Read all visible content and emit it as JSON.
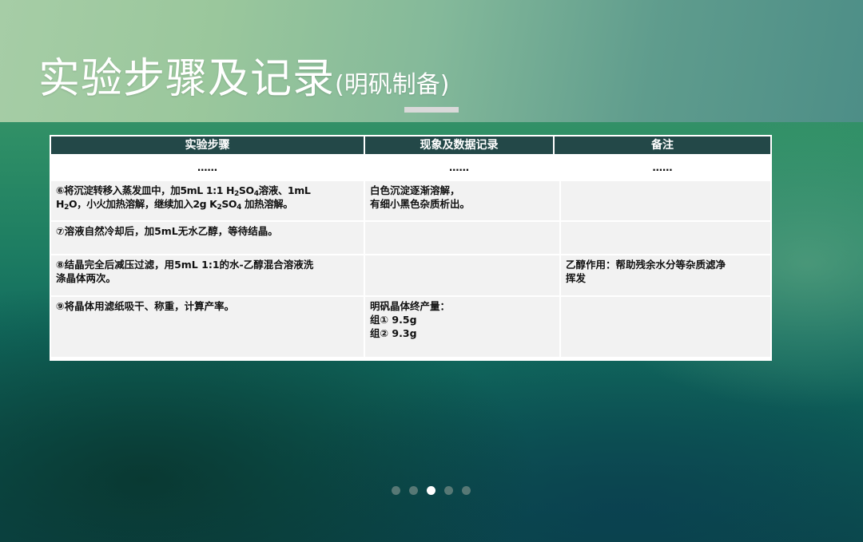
{
  "slide": {
    "title": "实验步骤及记录",
    "subtitle": "(明矾制备)"
  },
  "table": {
    "headers": [
      "实验步骤",
      "现象及数据记录",
      "备注"
    ],
    "rows": [
      {
        "step": "……",
        "record": "……",
        "note": "……"
      },
      {
        "step_line1_a": "⑥将沉淀转移入蒸发皿中，加5mL 1:1 H",
        "step_line1_sub1": "2",
        "step_line1_b": "SO",
        "step_line1_sub2": "4",
        "step_line1_c": "溶液、1mL",
        "step_line2_a": "H",
        "step_line2_sub1": "2",
        "step_line2_b": "O，小火加热溶解，继续加入2g K",
        "step_line2_sub2": "2",
        "step_line2_c": "SO",
        "step_line2_sub3": "4",
        "step_line2_d": " 加热溶解。",
        "record_line1": "白色沉淀逐渐溶解，",
        "record_line2": "有细小黑色杂质析出。",
        "note": ""
      },
      {
        "step": "⑦溶液自然冷却后，加5mL无水乙醇，等待结晶。",
        "record": "",
        "note": ""
      },
      {
        "step_line1": "⑧结晶完全后减压过滤，用5mL 1:1的水-乙醇混合溶液洗",
        "step_line2": "涤晶体两次。",
        "record": "",
        "note_line1": "乙醇作用：帮助残余水分等杂质滤净",
        "note_line2": "挥发"
      },
      {
        "step": "⑨将晶体用滤纸吸干、称重，计算产率。",
        "record_line1": "明矾晶体终产量：",
        "record_line2": "组① 9.5g",
        "record_line3": "组② 9.3g",
        "note": ""
      }
    ]
  },
  "pagination": {
    "total": 5,
    "active_index": 2
  },
  "colors": {
    "header_fill": "#234848",
    "cell_fill": "#f2f2f2",
    "dot_inactive": "#5f7d7a",
    "dot_active": "#ffffff"
  }
}
